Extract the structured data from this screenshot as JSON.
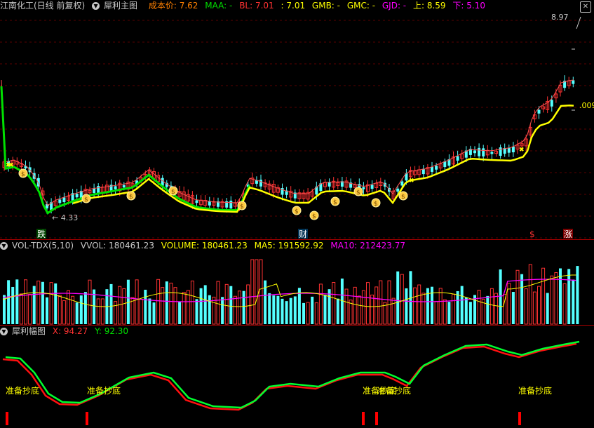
{
  "main": {
    "stock": "江南化工(日线 前复权)",
    "indicator": "犀利主图",
    "cost_label": "成本价: 7.62",
    "maa": "MAA: -",
    "bl": "BL: 7.01",
    "v4": ": 7.01",
    "gmb": "GMB: -",
    "gmc": "GMC: -",
    "gjd": "GJD: -",
    "up": "上: 8.59",
    "down": "下: 5.10",
    "high_label": "8.97",
    "low_label": "4.33",
    "right_label": ".009",
    "signals": {
      "die": "跌",
      "cai": "财",
      "dollar": "$",
      "zhang": "涨"
    }
  },
  "vol": {
    "name": "VOL-TDX(5,10)",
    "vvol": "VVOL: 180461.23",
    "volume": "VOLUME: 180461.23",
    "ma5": "MA5: 191592.92",
    "ma10": "MA10: 212423.77"
  },
  "sub": {
    "name": "犀利幅图",
    "x": "X: 94.27",
    "y": "Y: 92.30",
    "label": "准备抄底"
  },
  "colors": {
    "up": "#ff3232",
    "down": "#54ffff",
    "ma_yellow": "#ffff00",
    "ma_green": "#00e000",
    "ma10_purple": "#ff00ff",
    "orange": "#ff8000",
    "pink": "#ff5050"
  }
}
